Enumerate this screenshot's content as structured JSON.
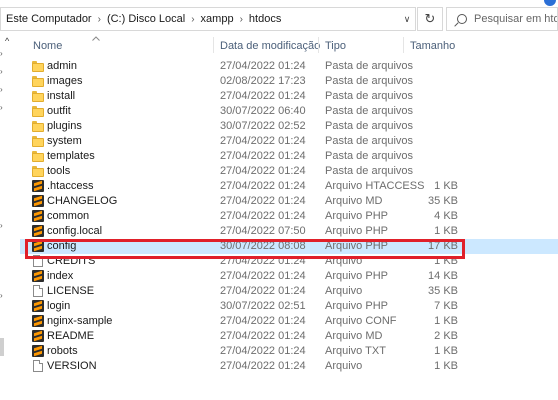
{
  "addressbar": {
    "breadcrumbs": [
      "Este Computador",
      "(C:) Disco Local",
      "xampp",
      "htdocs"
    ]
  },
  "search": {
    "placeholder": "Pesquisar em htd..."
  },
  "columns": {
    "name": "Nome",
    "date": "Data de modificação",
    "type": "Tipo",
    "size": "Tamanho"
  },
  "files": [
    {
      "name": "admin",
      "date": "27/04/2022 01:24",
      "type": "Pasta de arquivos",
      "size": "",
      "icon": "folder-icon"
    },
    {
      "name": "images",
      "date": "02/08/2022 17:23",
      "type": "Pasta de arquivos",
      "size": "",
      "icon": "folder-icon"
    },
    {
      "name": "install",
      "date": "27/04/2022 01:24",
      "type": "Pasta de arquivos",
      "size": "",
      "icon": "folder-icon"
    },
    {
      "name": "outfit",
      "date": "30/07/2022 06:40",
      "type": "Pasta de arquivos",
      "size": "",
      "icon": "folder-icon"
    },
    {
      "name": "plugins",
      "date": "30/07/2022 02:52",
      "type": "Pasta de arquivos",
      "size": "",
      "icon": "folder-icon"
    },
    {
      "name": "system",
      "date": "27/04/2022 01:24",
      "type": "Pasta de arquivos",
      "size": "",
      "icon": "folder-icon"
    },
    {
      "name": "templates",
      "date": "27/04/2022 01:24",
      "type": "Pasta de arquivos",
      "size": "",
      "icon": "folder-icon"
    },
    {
      "name": "tools",
      "date": "27/04/2022 01:24",
      "type": "Pasta de arquivos",
      "size": "",
      "icon": "folder-icon"
    },
    {
      "name": ".htaccess",
      "date": "27/04/2022 01:24",
      "type": "Arquivo HTACCESS",
      "size": "1 KB",
      "icon": "sublime-text-icon"
    },
    {
      "name": "CHANGELOG",
      "date": "27/04/2022 01:24",
      "type": "Arquivo MD",
      "size": "35 KB",
      "icon": "sublime-text-icon"
    },
    {
      "name": "common",
      "date": "27/04/2022 01:24",
      "type": "Arquivo PHP",
      "size": "4 KB",
      "icon": "sublime-text-icon"
    },
    {
      "name": "config.local",
      "date": "27/04/2022 07:50",
      "type": "Arquivo PHP",
      "size": "1 KB",
      "icon": "sublime-text-icon"
    },
    {
      "name": "config",
      "date": "30/07/2022 08:08",
      "type": "Arquivo PHP",
      "size": "17 KB",
      "icon": "sublime-text-icon",
      "selected": true
    },
    {
      "name": "CREDITS",
      "date": "27/04/2022 01:24",
      "type": "Arquivo",
      "size": "1 KB",
      "icon": "file-icon"
    },
    {
      "name": "index",
      "date": "27/04/2022 01:24",
      "type": "Arquivo PHP",
      "size": "14 KB",
      "icon": "sublime-text-icon"
    },
    {
      "name": "LICENSE",
      "date": "27/04/2022 01:24",
      "type": "Arquivo",
      "size": "35 KB",
      "icon": "file-icon"
    },
    {
      "name": "login",
      "date": "30/07/2022 02:51",
      "type": "Arquivo PHP",
      "size": "7 KB",
      "icon": "sublime-text-icon"
    },
    {
      "name": "nginx-sample",
      "date": "27/04/2022 01:24",
      "type": "Arquivo CONF",
      "size": "1 KB",
      "icon": "sublime-text-icon"
    },
    {
      "name": "README",
      "date": "27/04/2022 01:24",
      "type": "Arquivo MD",
      "size": "2 KB",
      "icon": "sublime-text-icon"
    },
    {
      "name": "robots",
      "date": "27/04/2022 01:24",
      "type": "Arquivo TXT",
      "size": "1 KB",
      "icon": "sublime-text-icon"
    },
    {
      "name": "VERSION",
      "date": "27/04/2022 01:24",
      "type": "Arquivo",
      "size": "1 KB",
      "icon": "file-icon"
    }
  ],
  "colors": {
    "selection": "#cce8ff",
    "highlight_border": "#e0202a",
    "header_text": "#4c607a"
  }
}
